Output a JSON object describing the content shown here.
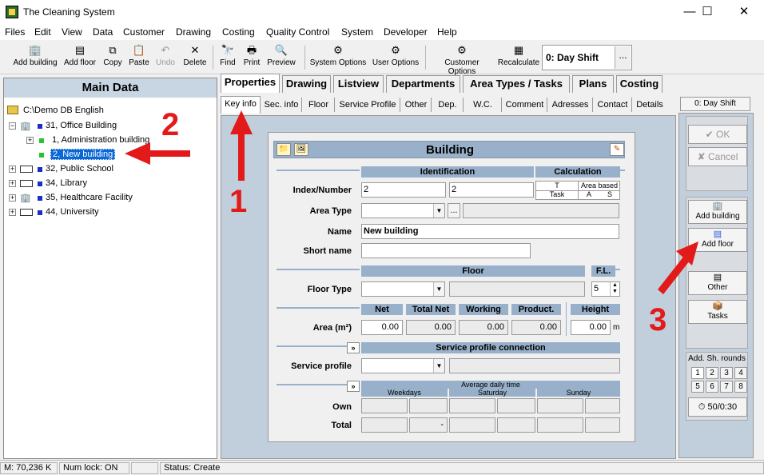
{
  "window": {
    "title": "The Cleaning System",
    "minimize": "—",
    "maximize": "☐",
    "close": "✕"
  },
  "menu": [
    "Files",
    "Edit",
    "View",
    "Data",
    "Customer",
    "Drawing",
    "Costing",
    "Quality Control",
    "System",
    "Developer",
    "Help"
  ],
  "toolbar": {
    "add_building": "Add building",
    "add_floor": "Add floor",
    "copy": "Copy",
    "paste": "Paste",
    "undo": "Undo",
    "delete": "Delete",
    "find": "Find",
    "print": "Print",
    "preview": "Preview",
    "system_options": "System Options",
    "user_options": "User Options",
    "customer_options": "Customer Options",
    "recalculate": "Recalculate",
    "shift": "0: Day Shift",
    "shift_more": "..."
  },
  "left": {
    "header": "Main Data",
    "root": "C:\\Demo DB English",
    "items": [
      "31, Office Building",
      "1, Administration building",
      "2, New building",
      "32, Public School",
      "34, Library",
      "35, Healthcare Facility",
      "44, University"
    ]
  },
  "tabs": {
    "main": [
      "Properties",
      "Drawing",
      "Listview",
      "Departments",
      "Area Types / Tasks",
      "Plans",
      "Costing"
    ],
    "sub": [
      "Key info",
      "Sec. info",
      "Floor",
      "Service Profile",
      "Other",
      "Dep.",
      "W.C.",
      "Comment",
      "Adresses",
      "Contact",
      "Details"
    ]
  },
  "form": {
    "title": "Building",
    "identification": "Identification",
    "calculation": "Calculation",
    "calc_t": "T",
    "calc_area_based": "Area based",
    "calc_task": "Task",
    "calc_a": "A",
    "calc_s": "S",
    "index_label": "Index/Number",
    "index1": "2",
    "index2": "2",
    "area_type_label": "Area Type",
    "area_type_btn": "...",
    "name_label": "Name",
    "name_value": "New building",
    "short_name_label": "Short name",
    "floor_hdr": "Floor",
    "fl_hdr": "F.L.",
    "floor_type_label": "Floor Type",
    "fl_value": "5",
    "net": "Net",
    "total_net": "Total Net",
    "working": "Working",
    "product": "Product.",
    "height": "Height",
    "area_label": "Area (m²)",
    "net_val": "0.00",
    "total_net_val": "0.00",
    "working_val": "0.00",
    "product_val": "0.00",
    "height_val": "0.00",
    "height_unit": "m",
    "sp_conn": "Service profile connection",
    "sp_label": "Service profile",
    "avg_daily": "Average daily time",
    "weekdays": "Weekdays",
    "saturday": "Saturday",
    "sunday": "Sunday",
    "own_label": "Own",
    "total_label": "Total",
    "total_dash": "-",
    "expand": "»"
  },
  "side": {
    "shift": "0: Day Shift",
    "ok": "OK",
    "cancel": "Cancel",
    "add_building": "Add building",
    "add_floor": "Add floor",
    "other": "Other",
    "tasks": "Tasks",
    "add_rounds": "Add. Sh. rounds",
    "rounds": [
      "1",
      "2",
      "3",
      "4",
      "5",
      "6",
      "7",
      "8"
    ],
    "time": "50/0:30"
  },
  "annotations": {
    "n1": "1",
    "n2": "2",
    "n3": "3"
  },
  "status": {
    "memory": "M: 70,236 K",
    "numlock": "Num lock: ON",
    "status": "Status: Create"
  }
}
